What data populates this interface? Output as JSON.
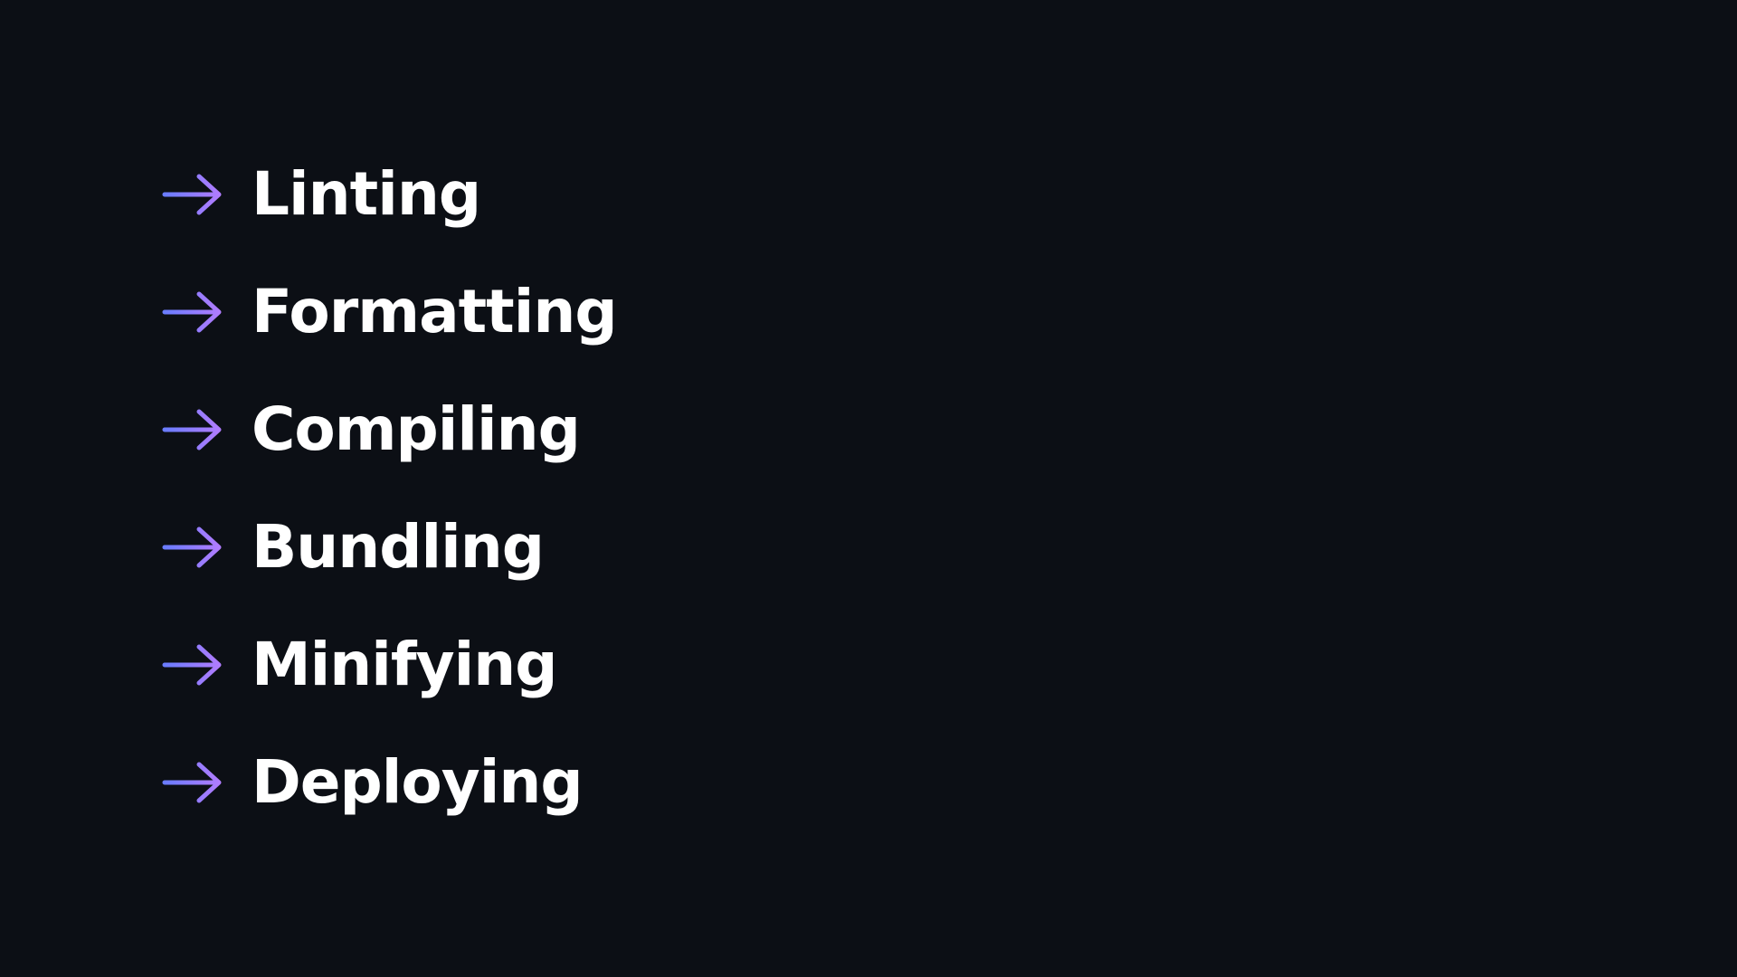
{
  "theme": {
    "background": "#0c0f15",
    "text_color": "#ffffff",
    "arrow_gradient_start": "#6a7cff",
    "arrow_gradient_end": "#b07cff"
  },
  "list": {
    "bullet_icon": "arrow-right-icon",
    "items": [
      {
        "label": "Linting"
      },
      {
        "label": "Formatting"
      },
      {
        "label": "Compiling"
      },
      {
        "label": "Bundling"
      },
      {
        "label": "Minifying"
      },
      {
        "label": "Deploying"
      }
    ]
  }
}
